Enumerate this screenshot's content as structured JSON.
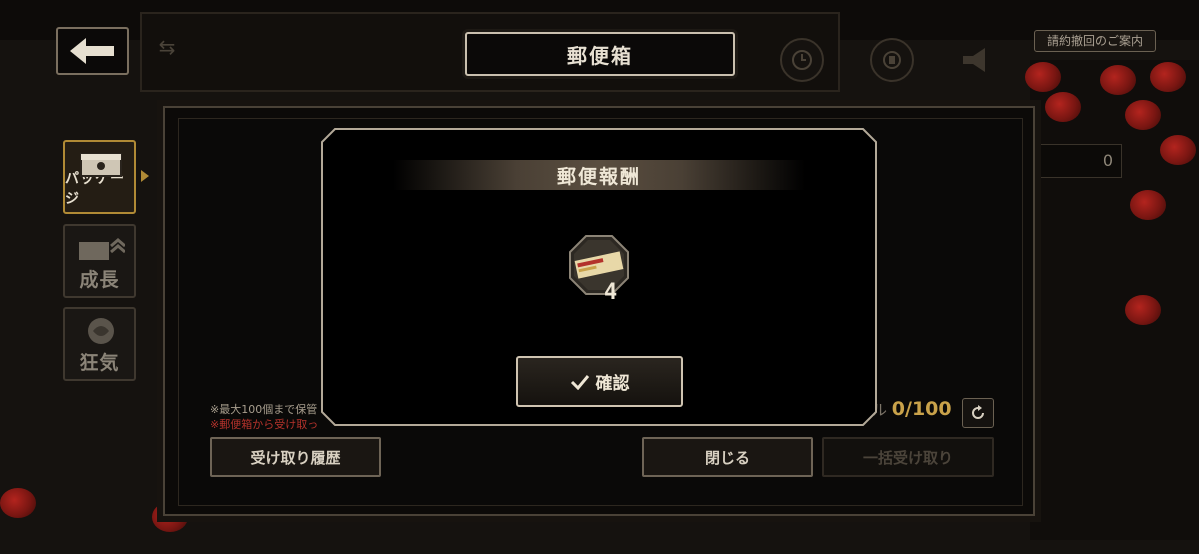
{
  "header": {
    "title": "郵便箱",
    "notice_button": "請約撤回のご案内"
  },
  "sidebar": {
    "items": [
      {
        "label": "パッケージ",
        "active": true
      },
      {
        "label": "成長",
        "active": false
      },
      {
        "label": "狂気",
        "active": false
      }
    ]
  },
  "mailbox": {
    "note_line1": "※最大100個まで保管",
    "note_line2": "※郵便箱から受け取っ",
    "counter_prefix": "ル",
    "counter_value": "0/100",
    "right_field_value": "0",
    "buttons": {
      "history": "受け取り履歴",
      "close": "閉じる",
      "claim_all": "一括受け取り"
    }
  },
  "modal": {
    "title": "郵便報酬",
    "reward": {
      "icon": "ticket-icon",
      "quantity": "4"
    },
    "confirm_label": "確認"
  },
  "colors": {
    "gold_accent": "#b08a35",
    "rose_red": "#b3241e",
    "counter_gold": "#c9a24a"
  }
}
